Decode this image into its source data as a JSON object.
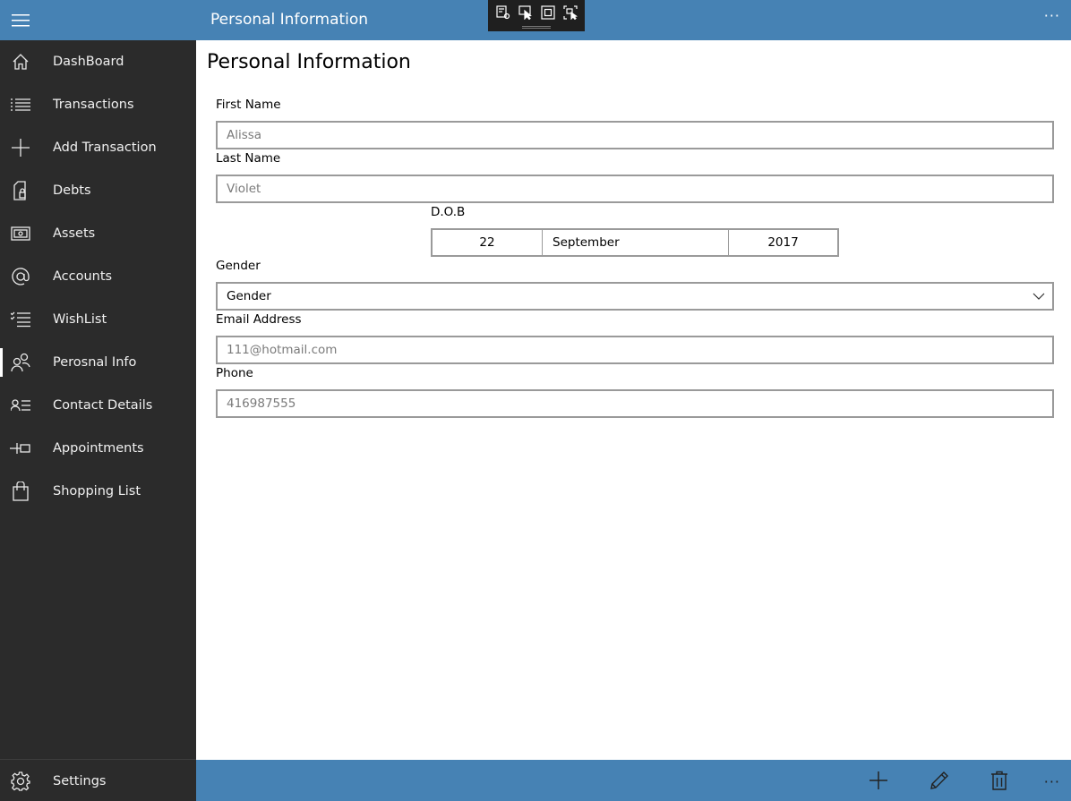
{
  "header": {
    "title": "Personal Information",
    "more_label": "···",
    "accent": "#4682b4"
  },
  "sidebar": {
    "background": "#2b2b2b",
    "items": [
      {
        "label": "DashBoard",
        "icon": "home-icon"
      },
      {
        "label": "Transactions",
        "icon": "list-icon"
      },
      {
        "label": "Add Transaction",
        "icon": "plus-icon"
      },
      {
        "label": "Debts",
        "icon": "document-lock-icon"
      },
      {
        "label": "Assets",
        "icon": "money-icon"
      },
      {
        "label": "Accounts",
        "icon": "at-sign-icon"
      },
      {
        "label": "WishList",
        "icon": "checklist-icon"
      },
      {
        "label": "Perosnal Info",
        "icon": "people-icon",
        "selected": true
      },
      {
        "label": "Contact Details",
        "icon": "contact-list-icon"
      },
      {
        "label": "Appointments",
        "icon": "pin-icon"
      },
      {
        "label": "Shopping List",
        "icon": "shopping-bag-icon"
      }
    ],
    "settings": {
      "label": "Settings",
      "icon": "gear-icon"
    }
  },
  "main": {
    "title": "Personal Information",
    "first_name": {
      "label": "First Name",
      "placeholder": "Alissa"
    },
    "last_name": {
      "label": "Last Name",
      "placeholder": "Violet"
    },
    "dob": {
      "label": "D.O.B",
      "day": "22",
      "month": "September",
      "year": "2017"
    },
    "gender": {
      "label": "Gender",
      "value": "Gender"
    },
    "email": {
      "label": "Email Address",
      "placeholder": "111@hotmail.com"
    },
    "phone": {
      "label": "Phone",
      "placeholder": "416987555"
    }
  },
  "command_bar": {
    "buttons": [
      "add-icon",
      "edit-pencil-icon",
      "delete-trash-icon"
    ],
    "more_label": "···"
  }
}
